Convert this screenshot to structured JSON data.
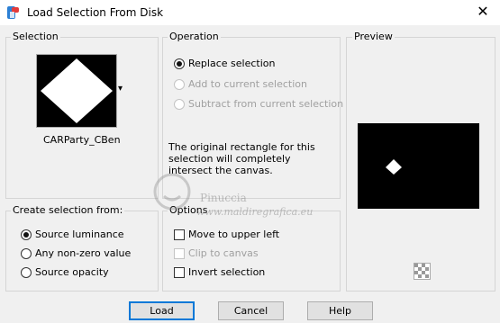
{
  "window": {
    "title": "Load Selection From Disk",
    "close_glyph": "✕"
  },
  "selection_group": {
    "label": "Selection",
    "file_name": "CARParty_CBen",
    "dropdown_glyph": "▾"
  },
  "operation_group": {
    "label": "Operation",
    "options": [
      {
        "label": "Replace selection",
        "selected": true,
        "enabled": true
      },
      {
        "label": "Add to current selection",
        "selected": false,
        "enabled": false
      },
      {
        "label": "Subtract from current selection",
        "selected": false,
        "enabled": false
      }
    ],
    "info_text": "The original rectangle for this selection will completely intersect the canvas."
  },
  "preview_group": {
    "label": "Preview"
  },
  "create_group": {
    "label": "Create selection from:",
    "options": [
      {
        "label": "Source luminance",
        "selected": true
      },
      {
        "label": "Any non-zero value",
        "selected": false
      },
      {
        "label": "Source opacity",
        "selected": false
      }
    ]
  },
  "options_group": {
    "label": "Options",
    "items": [
      {
        "label": "Move to upper left",
        "checked": false,
        "enabled": true
      },
      {
        "label": "Clip to canvas",
        "checked": false,
        "enabled": false
      },
      {
        "label": "Invert selection",
        "checked": false,
        "enabled": true
      }
    ]
  },
  "buttons": {
    "load": "Load",
    "cancel": "Cancel",
    "help": "Help"
  },
  "watermark": {
    "name": "Pinuccia",
    "url": "www.maldiregrafica.eu"
  },
  "colors": {
    "default_button_border": "#0078d7",
    "preview_bg": "#000000"
  }
}
